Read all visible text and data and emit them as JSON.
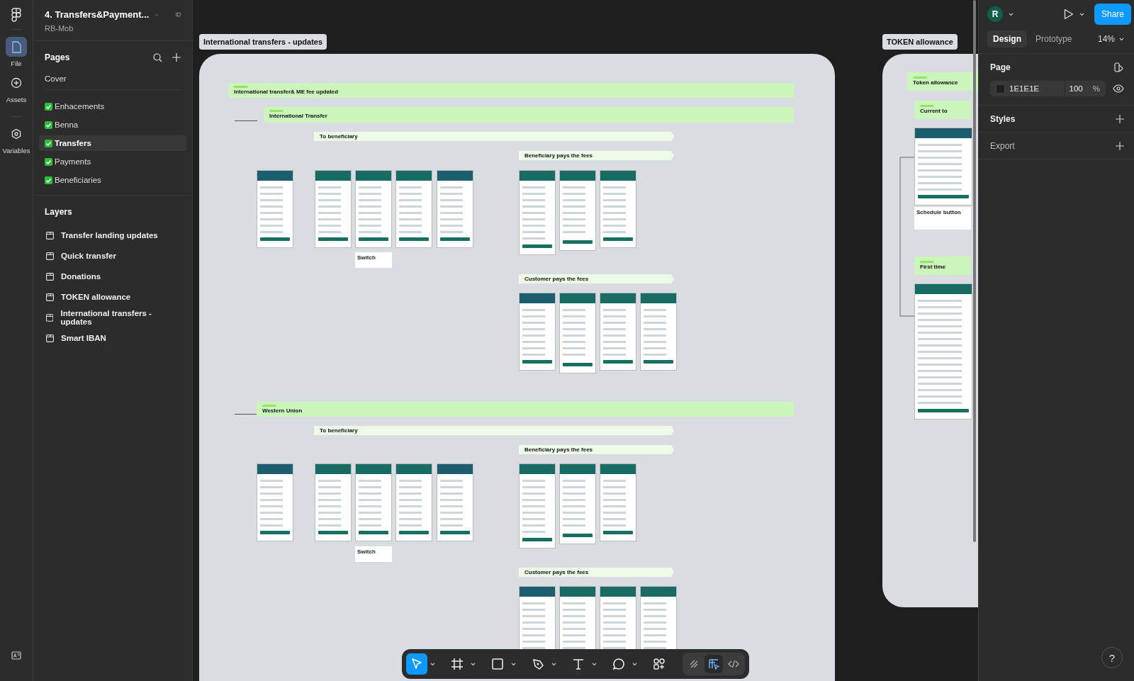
{
  "file": {
    "title": "4. Transfers&Payment...",
    "project": "RB-Mob"
  },
  "rail": [
    {
      "kind": "file",
      "label": "File",
      "selected": true
    },
    {
      "kind": "assets",
      "label": "Assets",
      "selected": false
    },
    {
      "kind": "variables",
      "label": "Variables",
      "selected": false
    }
  ],
  "pages": {
    "title": "Pages",
    "items": [
      {
        "label": "Cover",
        "done": false,
        "selected": false
      },
      {
        "label": "Enhacements",
        "done": true,
        "selected": false
      },
      {
        "label": "Benna",
        "done": true,
        "selected": false
      },
      {
        "label": "Transfers",
        "done": true,
        "selected": true
      },
      {
        "label": "Payments",
        "done": true,
        "selected": false
      },
      {
        "label": "Beneficiaries",
        "done": true,
        "selected": false
      }
    ]
  },
  "layers": {
    "title": "Layers",
    "items": [
      {
        "label": "Transfer landing updates"
      },
      {
        "label": "Quick transfer"
      },
      {
        "label": "Donations"
      },
      {
        "label": "TOKEN allowance"
      },
      {
        "label": "International transfers - updates"
      },
      {
        "label": "Smart IBAN"
      }
    ]
  },
  "canvas": {
    "frames": [
      {
        "label": "International transfers - updates",
        "bars": [
          {
            "kind": "section",
            "label": "International transfer& ME fee updated"
          },
          {
            "kind": "section",
            "label": "International Transfer"
          },
          {
            "kind": "flow",
            "label": "To beneficiary"
          },
          {
            "kind": "flow",
            "label": "Beneficiary pays the fees"
          },
          {
            "kind": "flow",
            "label": "Customer pays the fees"
          },
          {
            "kind": "section",
            "label": "Western Union"
          },
          {
            "kind": "flow",
            "label": "To beneficiary"
          },
          {
            "kind": "flow",
            "label": "Beneficiary pays the fees"
          },
          {
            "kind": "flow",
            "label": "Customer pays the fees"
          }
        ],
        "notes": [
          {
            "label": "Switch"
          },
          {
            "label": "Switch"
          }
        ]
      },
      {
        "label": "TOKEN allowance",
        "bars": [
          {
            "kind": "section",
            "label": "Token allowance"
          },
          {
            "kind": "section",
            "label": "Current to"
          },
          {
            "kind": "section",
            "label": "First time"
          }
        ],
        "notes": [
          {
            "label": "Schedule button"
          }
        ]
      }
    ]
  },
  "right_panel": {
    "avatar": "R",
    "share": "Share",
    "tabs": [
      {
        "label": "Design",
        "selected": true
      },
      {
        "label": "Prototype",
        "selected": false
      }
    ],
    "zoom": "14%",
    "page": {
      "title": "Page",
      "color": "1E1E1E",
      "opacity": "100",
      "unit": "%"
    },
    "sections": [
      {
        "label": "Styles"
      },
      {
        "label": "Export"
      }
    ]
  },
  "toolbar": {
    "tools": [
      {
        "kind": "move",
        "selected": true
      },
      {
        "kind": "frame",
        "selected": false
      },
      {
        "kind": "shape",
        "selected": false
      },
      {
        "kind": "pen",
        "selected": false
      },
      {
        "kind": "text",
        "selected": false
      },
      {
        "kind": "comment",
        "selected": false
      },
      {
        "kind": "actions",
        "selected": false
      }
    ],
    "modes": [
      {
        "kind": "draw",
        "selected": false
      },
      {
        "kind": "design",
        "selected": true
      },
      {
        "kind": "dev",
        "selected": false
      }
    ]
  },
  "help": "?"
}
